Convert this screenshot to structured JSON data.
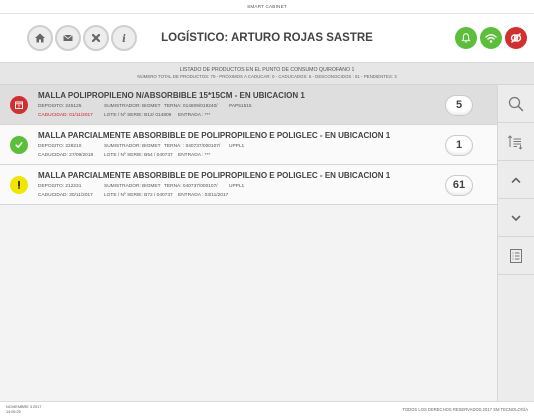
{
  "app": {
    "title": "SMART CABINET"
  },
  "header": {
    "title": "LOGÍSTICO: ARTURO ROJAS SASTRE",
    "nav_icons": [
      "home-icon",
      "mail-icon",
      "close-icon",
      "info-icon"
    ],
    "status_icons": [
      "bell-icon",
      "wifi-icon",
      "no-connection-icon"
    ],
    "colors": {
      "green": "#5bbf3a",
      "red": "#d32f2f"
    }
  },
  "summary": {
    "line1": "LISTADO DE PRODUCTOS EN EL PUNTO DE CONSUMO QUIROFANO 1",
    "line2": "NÚMERO TOTAL DE PRODUCTOS: 79  -  PRÓXIMOS A CADUCAR: 0  -  CADUCADOS: 6  -  DESCONOCIDOS : 61  -  PENDIENTES: 3"
  },
  "products": [
    {
      "status": "expired",
      "status_icon": "calendar-alert-icon",
      "title": "MALLA POLIPROPILENO N/ABSORBIBLE 15*15CM   -   EN UBICACION 1",
      "deposito": "DEPOSITO: 245125",
      "sumistrador": "SUMISTRADOR: BIOMET",
      "terna": "TERNA: 014809/019240/",
      "ref": "PAP51515",
      "caducidad": "CADUCIDAD: 01/11/2017",
      "lote": "LOTE / Nº SERIE: B12/ 014809",
      "entrada": "ENTRADA : ***",
      "count": "5"
    },
    {
      "status": "ok",
      "status_icon": "check-icon",
      "title": "MALLA PARCIALMENTE ABSORBIBLE DE POLIPROPILENO E POLIGLEC   -   EN UBICACION 1",
      "deposito": "DEPOSITO: 228210",
      "sumistrador": "SUMISTRADOR: BIOMET",
      "terna": "TERNA: : 040737/000107/",
      "ref": "UPPL1",
      "caducidad": "CADUCIDAD: 27/09/2018",
      "lote": "LOTE / Nº SERIE: B54 / 040737",
      "entrada": "ENTRADA : ***",
      "count": "1"
    },
    {
      "status": "warning",
      "status_icon": "exclamation-icon",
      "title": "MALLA PARCIALMENTE ABSORBIBLE DE POLIPROPILENO E POLIGLEC   -   EN UBICACION 1",
      "deposito": "DEPOSITO: 212231",
      "sumistrador": "SUMISTRADOR: BIOMET",
      "terna": "TERNA: 040737/000107/",
      "ref": "UPPL1",
      "caducidad": "CADUCIDAD: 30/11/2017",
      "lote": "LOTE / Nº SERIE: B72 / 040737",
      "entrada": "ENTRADA : 03/11/2017",
      "count": "61"
    }
  ],
  "sidebar": {
    "buttons": [
      "search-icon",
      "sort-icon",
      "chevron-up-icon",
      "chevron-down-icon",
      "list-icon"
    ]
  },
  "footer": {
    "date": "NOVIEMBRE 3 2017",
    "time": "14:05:25",
    "copyright": "TODOS LOS DERECHOS RESERVADOS 2017 SM TECNOLOGÍA"
  }
}
